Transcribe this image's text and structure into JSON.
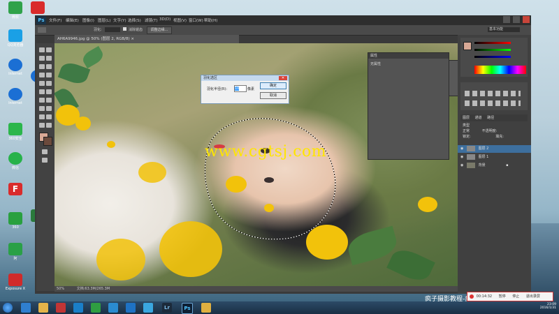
{
  "desktop_icons": [
    {
      "label": "微软",
      "color": "#2fa24a"
    },
    {
      "label": "QQ浏览器",
      "color": "#1aa0e6"
    },
    {
      "label": "Internet",
      "color": "#1b6fd4"
    },
    {
      "label": "Internet",
      "color": "#1b6fd4"
    },
    {
      "label": "360安全",
      "color": "#2bb64b"
    },
    {
      "label": "Exposure",
      "color": "#1c7ad0"
    },
    {
      "label": "微信",
      "color": "#27b24a"
    },
    {
      "label": "F",
      "color": "#d92b2b"
    },
    {
      "label": "360",
      "color": "#29a03f"
    },
    {
      "label": "阿",
      "color": "#2aa047"
    },
    {
      "label": "Exposure X",
      "color": "#d02a2a"
    }
  ],
  "ps": {
    "logo": "Ps",
    "menu": [
      "文件(F)",
      "编辑(E)",
      "图像(I)",
      "图层(L)",
      "文字(Y)",
      "选择(S)",
      "滤镜(T)",
      "3D(D)",
      "视图(V)",
      "窗口(W)",
      "帮助(H)"
    ],
    "options": {
      "feather_label": "羽化:",
      "antialias_label": "消除锯齿",
      "refine_button": "调整边缘...",
      "workspace": "基本功能"
    },
    "doc_tab": "AH6A9946.jpg @ 50% (图层 2, RGB/8) ×",
    "status": {
      "zoom": "50%",
      "doc_info": "文档:63.3M/265.3M"
    }
  },
  "dialog": {
    "title": "羽化选区",
    "feather_radius_label": "羽化半径(R):",
    "feather_value": "10",
    "unit": "像素",
    "ok": "确定",
    "cancel": "取消"
  },
  "properties_panel": {
    "tab": "属性",
    "text": "无属性"
  },
  "layers_panel": {
    "tabs": [
      "图层",
      "通道",
      "路径"
    ],
    "filter_kind": "类型",
    "blend_mode": "正常",
    "opacity_label": "不透明度:",
    "lock_label": "锁定:",
    "fill_label": "填充:",
    "layers": [
      {
        "name": "图层 2",
        "selected": true
      },
      {
        "name": "图层 1",
        "selected": false
      },
      {
        "name": "背景",
        "selected": false
      }
    ]
  },
  "watermark": "www.cgtsj.com",
  "taskbar": {
    "apps": [
      "Lr",
      "Ps"
    ],
    "popup": {
      "time": "00:14:32",
      "pause": "暂停",
      "stop": "停止",
      "exit": "退出录屏"
    },
    "tray_time": "23:09",
    "tray_date": "2016/1/31"
  },
  "overlay_text": "疯子摄影教程-疯狂网",
  "colors": {
    "accent": "#3d6f9e",
    "watermark": "#ffe600",
    "canvas_bg": "#3a3a3a"
  }
}
